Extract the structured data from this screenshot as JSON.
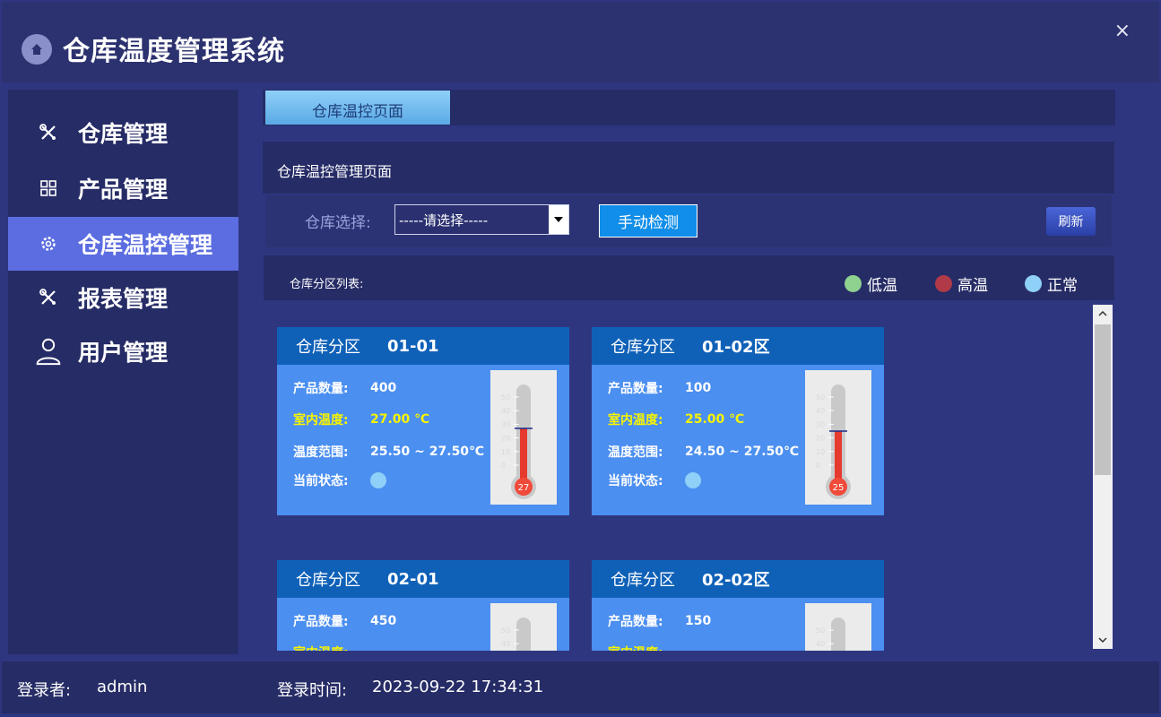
{
  "app": {
    "title": "仓库温度管理系统",
    "close_glyph": "×"
  },
  "sidebar": {
    "items": [
      {
        "label": "仓库管理",
        "icon": "tools-icon"
      },
      {
        "label": "产品管理",
        "icon": "grid-icon"
      },
      {
        "label": "仓库温控管理",
        "icon": "gear-icon",
        "active": true
      },
      {
        "label": "报表管理",
        "icon": "tools-icon"
      },
      {
        "label": "用户管理",
        "icon": "user-icon"
      }
    ]
  },
  "tabs": [
    {
      "label": "仓库温控页面"
    }
  ],
  "panel": {
    "title": "仓库温控管理页面"
  },
  "filter": {
    "label": "仓库选择:",
    "select_value": "-----请选择-----",
    "detect_button": "手动检测",
    "refresh_button": "刷新"
  },
  "list": {
    "title": "仓库分区列表:",
    "legend": [
      {
        "label": "低温",
        "color": "#8fd18f"
      },
      {
        "label": "高温",
        "color": "#b03a48"
      },
      {
        "label": "正常",
        "color": "#8fd0f8"
      }
    ]
  },
  "cards": [
    {
      "zone_label": "仓库分区",
      "zone_id": "01-01",
      "qty_label": "产品数量:",
      "qty": "400",
      "temp_label": "室内温度:",
      "temp": "27.00 ℃",
      "range_label": "温度范围:",
      "range": "25.50 ~ 27.50℃",
      "status_label": "当前状态:",
      "bulb": "27",
      "level": 27
    },
    {
      "zone_label": "仓库分区",
      "zone_id": "01-02区",
      "qty_label": "产品数量:",
      "qty": "100",
      "temp_label": "室内温度:",
      "temp": "25.00 ℃",
      "range_label": "温度范围:",
      "range": "24.50 ~ 27.50℃",
      "status_label": "当前状态:",
      "bulb": "25",
      "level": 25
    },
    {
      "zone_label": "仓库分区",
      "zone_id": "02-01",
      "qty_label": "产品数量:",
      "qty": "450",
      "temp_label": "室内温度:",
      "temp": "",
      "range_label": "",
      "range": "",
      "status_label": "",
      "bulb": "",
      "level": 0
    },
    {
      "zone_label": "仓库分区",
      "zone_id": "02-02区",
      "qty_label": "产品数量:",
      "qty": "150",
      "temp_label": "室内温度:",
      "temp": "",
      "range_label": "",
      "range": "",
      "status_label": "",
      "bulb": "",
      "level": 0
    }
  ],
  "thermometer_scale": [
    "50",
    "40",
    "30",
    "20",
    "10",
    "0"
  ],
  "status_bar": {
    "user_label": "登录者:",
    "user": "admin",
    "time_label": "登录时间:",
    "time": "2023-09-22 17:34:31"
  }
}
